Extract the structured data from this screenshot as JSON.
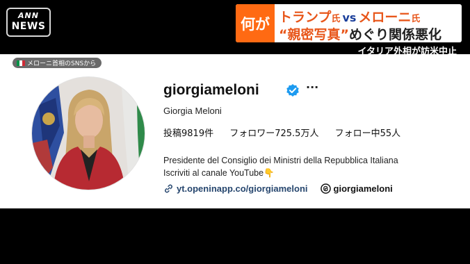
{
  "broadcast": {
    "logo_top": "ANN",
    "logo_bottom": "NEWS",
    "headline_tag": "何が",
    "headline_line1_a": "トランプ",
    "headline_line1_a_suffix": "氏",
    "headline_line1_vs": "vs",
    "headline_line1_b": "メローニ",
    "headline_line1_b_suffix": "氏",
    "headline_line2_quote": "“親密写真”",
    "headline_line2_rest": "めぐり関係悪化",
    "subhead": "イタリア外相が訪米中止",
    "colors": {
      "accent": "#ff6a13",
      "vs": "#1b3f9b"
    }
  },
  "profile": {
    "source_label": "メローニ首相のSNSから",
    "username": "giorgiameloni",
    "verified_icon": "verified-badge-icon",
    "more_label": "···",
    "full_name": "Giorgia Meloni",
    "stats": {
      "posts": "投稿9819件",
      "followers": "フォロワー725.5万人",
      "following": "フォロー中55人"
    },
    "bio_line1": "Presidente del Consiglio dei Ministri della Repubblica Italiana",
    "bio_line2": "Iscriviti al canale YouTube",
    "bio_emoji": "👇",
    "link_url": "yt.openinapp.co/giorgiameloni",
    "threads_handle": "giorgiameloni"
  }
}
